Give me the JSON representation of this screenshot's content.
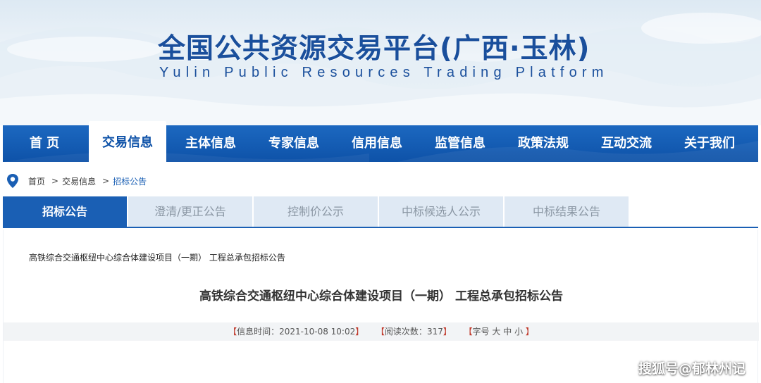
{
  "banner": {
    "title": "全国公共资源交易平台(广西·玉林)",
    "subtitle": "Yulin Public Resources Trading Platform"
  },
  "nav": {
    "items": [
      {
        "label": "首  页",
        "active": false
      },
      {
        "label": "交易信息",
        "active": true
      },
      {
        "label": "主体信息",
        "active": false
      },
      {
        "label": "专家信息",
        "active": false
      },
      {
        "label": "信用信息",
        "active": false
      },
      {
        "label": "监管信息",
        "active": false
      },
      {
        "label": "政策法规",
        "active": false
      },
      {
        "label": "互动交流",
        "active": false
      },
      {
        "label": "关于我们",
        "active": false
      }
    ]
  },
  "breadcrumb": {
    "icon": "location-pin-icon",
    "items": [
      "首页",
      "交易信息",
      "招标公告"
    ],
    "separator": ">"
  },
  "subtabs": [
    {
      "label": "招标公告",
      "active": true
    },
    {
      "label": "澄清/更正公告",
      "active": false
    },
    {
      "label": "控制价公示",
      "active": false
    },
    {
      "label": "中标候选人公示",
      "active": false
    },
    {
      "label": "中标结果公告",
      "active": false
    }
  ],
  "article": {
    "small_title": "高铁综合交通枢纽中心综合体建设项目（一期） 工程总承包招标公告",
    "title": "高铁综合交通枢纽中心综合体建设项目（一期） 工程总承包招标公告",
    "meta": {
      "open": "【",
      "close": "】",
      "time_label": "信息时间：",
      "time_value": "2021-10-08 10:02",
      "views_label": "阅读次数：",
      "views_value": "317",
      "fontsize_label": "字号",
      "fontsize_large": "大",
      "fontsize_medium": "中",
      "fontsize_small": "小"
    }
  },
  "watermark": "搜狐号@郁林州记",
  "colors": {
    "primary": "#1a5fb4",
    "nav": "#0e52a8",
    "title": "#1a4f9c"
  }
}
